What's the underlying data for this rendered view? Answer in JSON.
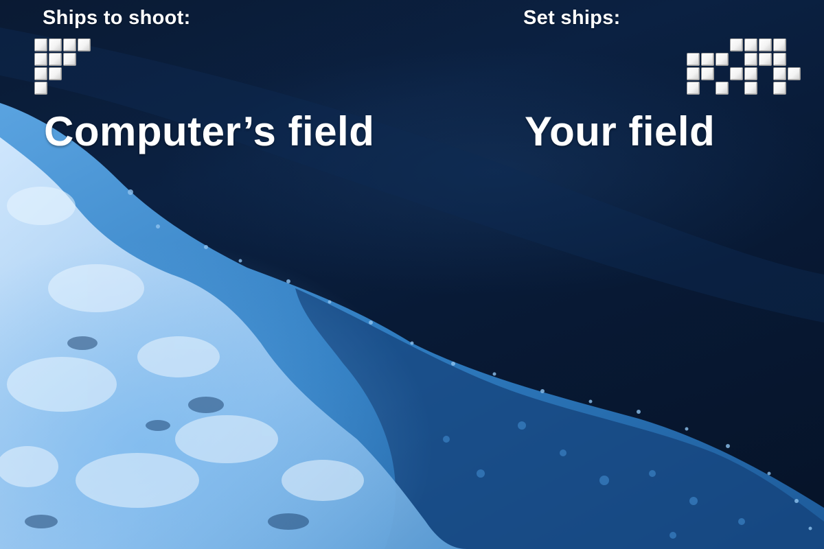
{
  "left_panel": {
    "label": "Ships to shoot:",
    "title": "Computer’s field",
    "ship_rows": [
      [
        1,
        1,
        1,
        1
      ],
      [
        1,
        1,
        1,
        0
      ],
      [
        1,
        1,
        0,
        0
      ],
      [
        1,
        0,
        0,
        0
      ]
    ]
  },
  "right_panel": {
    "label": "Set ships:",
    "title": "Your field",
    "ship_rows": [
      [
        0,
        0,
        0,
        1,
        1,
        1,
        1
      ],
      [
        1,
        1,
        1,
        0,
        1,
        1,
        1
      ],
      [
        1,
        1,
        0,
        1,
        1,
        0,
        1,
        1
      ],
      [
        1,
        0,
        1,
        0,
        1,
        0,
        1,
        0
      ]
    ]
  },
  "colors": {
    "text": "#ffffff",
    "ocean_dark": "#081226",
    "foam": "#cfe7ff"
  }
}
